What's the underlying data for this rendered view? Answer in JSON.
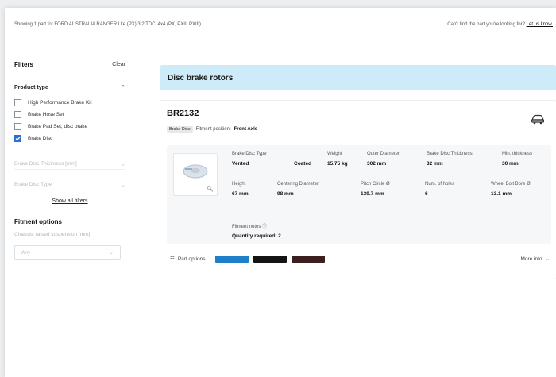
{
  "topbar": {
    "showing_text": "Showing 1 part for FORD AUSTRALIA RANGER Ute (PX) 3.2 TDCi 4x4 (PX, PXII, PXIII)",
    "help_text": "Can't find the part you're looking for?",
    "help_link": "Let us know."
  },
  "sidebar": {
    "filters_title": "Filters",
    "clear_label": "Clear",
    "product_type": {
      "title": "Product type",
      "options": [
        {
          "label": "High Performance Brake Kit",
          "checked": false
        },
        {
          "label": "Brake Hose Set",
          "checked": false
        },
        {
          "label": "Brake Pad Set, disc brake",
          "checked": false
        },
        {
          "label": "Brake Disc",
          "checked": true
        }
      ]
    },
    "collapsed_filters": [
      "Brake Disc Thickness [mm]",
      "Brake Disc Type"
    ],
    "show_all_label": "Show all filters",
    "fitment": {
      "title": "Fitment options",
      "subtitle": "Chassis: raised suspension [mm]",
      "select_value": "Any"
    }
  },
  "main": {
    "banner_title": "Disc brake rotors",
    "part": {
      "number": "BR2132",
      "tag": "Brake Disc",
      "fitment_label": "Fitment position:",
      "fitment_value": "Front Axle",
      "specs": [
        {
          "label": "Brake Disc Type",
          "value": "Vented"
        },
        {
          "label": "",
          "value": "Coated"
        },
        {
          "label": "Weight",
          "value": "15.75 kg"
        },
        {
          "label": "Outer Diameter",
          "value": "302 mm"
        },
        {
          "label": "Brake Disc Thickness",
          "value": "32 mm"
        },
        {
          "label": "Min. thickness",
          "value": "30 mm"
        },
        {
          "label": "Height",
          "value": "67 mm"
        },
        {
          "label": "Centering Diameter",
          "value": "98 mm"
        },
        {
          "label": "Pitch Circle Ø",
          "value": "139.7 mm"
        },
        {
          "label": "Num. of holes",
          "value": "6"
        },
        {
          "label": "Wheel Bolt Bore Ø",
          "value": "13.1 mm"
        }
      ],
      "notes_label": "Fitment notes ⓘ",
      "quantity": "Quantity required: 2.",
      "part_options_label": "Part options",
      "more_info_label": "More info"
    }
  }
}
